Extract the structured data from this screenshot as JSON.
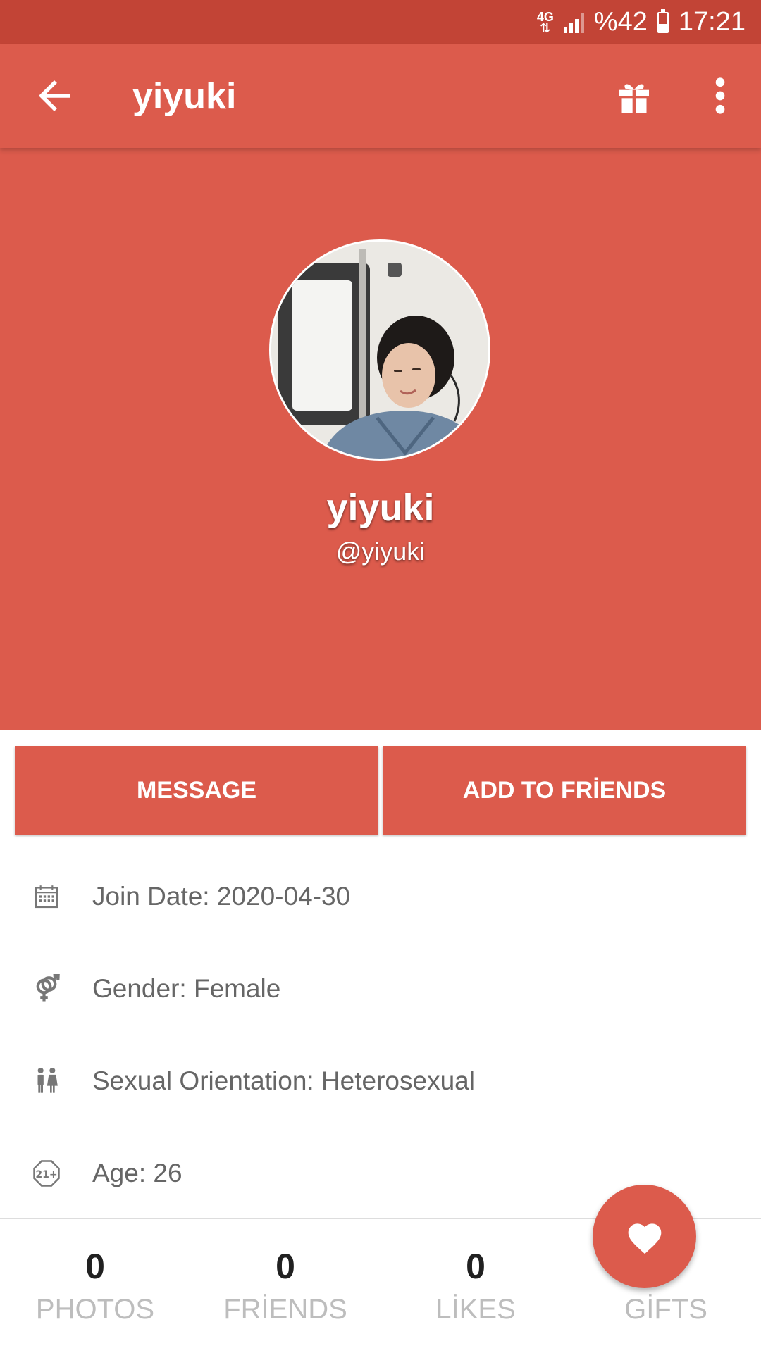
{
  "status_bar": {
    "network": "4G",
    "battery_text": "%42",
    "time": "17:21"
  },
  "app_bar": {
    "title": "yiyuki",
    "icons": [
      "back-arrow-icon",
      "gift-icon",
      "more-vert-icon"
    ]
  },
  "profile": {
    "name": "yiyuki",
    "handle": "@yiyuki"
  },
  "actions": {
    "message_label": "MESSAGE",
    "add_friend_label": "ADD TO FRİENDS"
  },
  "info": [
    {
      "icon": "calendar-icon",
      "text": "Join Date: 2020-04-30"
    },
    {
      "icon": "gender-icon",
      "text": "Gender: Female"
    },
    {
      "icon": "couple-icon",
      "text": "Sexual Orientation: Heterosexual"
    },
    {
      "icon": "age-21-icon",
      "text": "Age: 26"
    }
  ],
  "stats": [
    {
      "count": "0",
      "label": "PHOTOS"
    },
    {
      "count": "0",
      "label": "FRİENDS"
    },
    {
      "count": "0",
      "label": "LİKES"
    },
    {
      "count": "",
      "label": "GİFTS"
    }
  ],
  "colors": {
    "primary": "#dc5b4c",
    "status_bar": "#c24436"
  },
  "age_badge": "21+"
}
